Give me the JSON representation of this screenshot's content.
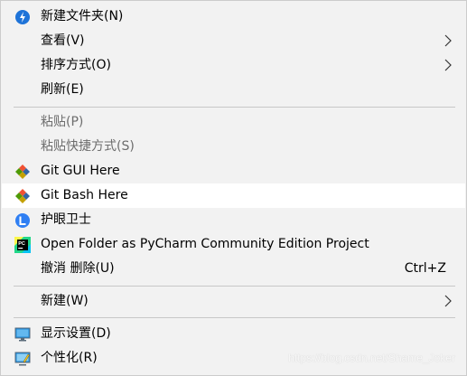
{
  "menu": {
    "items": [
      {
        "label": "新建文件夹(N)",
        "icon": "new-folder-icon"
      },
      {
        "label": "查看(V)",
        "submenu": true
      },
      {
        "label": "排序方式(O)",
        "submenu": true
      },
      {
        "label": "刷新(E)"
      },
      {
        "label": "粘贴(P)",
        "disabled": true
      },
      {
        "label": "粘贴快捷方式(S)",
        "disabled": true
      },
      {
        "label": "Git GUI Here",
        "icon": "git-icon"
      },
      {
        "label": "Git Bash Here",
        "icon": "git-icon",
        "highlighted": true
      },
      {
        "label": "护眼卫士",
        "icon": "eye-guard-icon"
      },
      {
        "label": "Open Folder as PyCharm Community Edition Project",
        "icon": "pycharm-icon"
      },
      {
        "label": "撤消 删除(U)",
        "shortcut": "Ctrl+Z"
      },
      {
        "label": "新建(W)",
        "submenu": true
      },
      {
        "label": "显示设置(D)",
        "icon": "display-settings-icon"
      },
      {
        "label": "个性化(R)",
        "icon": "personalize-icon"
      }
    ]
  },
  "watermark": "https://blog.csdn.net/Shame_Joker",
  "colors": {
    "menu_bg": "#f2f2f2",
    "highlight_bg": "#ffffff",
    "disabled_text": "#6d6d6d",
    "separator": "#c8c8c8",
    "accent_blue": "#1e73d8"
  }
}
